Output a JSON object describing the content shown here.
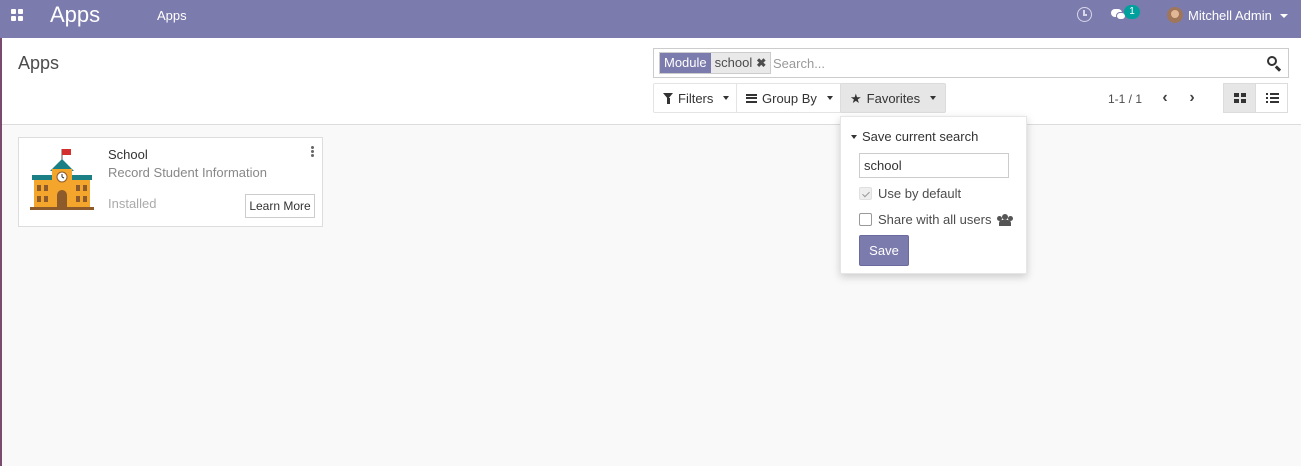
{
  "navbar": {
    "brand": "Apps",
    "menu_item": "Apps",
    "notification_count": "1",
    "user_name": "Mitchell Admin",
    "icons": [
      "apps-grid-icon",
      "clock-icon",
      "chat-icon",
      "avatar"
    ]
  },
  "control_panel": {
    "breadcrumb": "Apps",
    "search": {
      "facet_label": "Module",
      "facet_value": "school",
      "facet_remove": "✖",
      "placeholder": "Search..."
    },
    "filters_label": "Filters",
    "groupby_label": "Group By",
    "favorites_label": "Favorites",
    "pager": "1-1 / 1",
    "pager_prev": "‹",
    "pager_next": "›"
  },
  "favorites_menu": {
    "title": "Save current search",
    "name_value": "school",
    "use_by_default": "Use by default",
    "use_by_default_checked": true,
    "share_all": "Share with all users",
    "share_all_checked": false,
    "save_label": "Save"
  },
  "kanban": {
    "cards": [
      {
        "name": "School",
        "summary": "Record Student Information",
        "status": "Installed",
        "action": "Learn More"
      }
    ]
  },
  "colors": {
    "navbar": "#7c7bad",
    "badge": "#00a09d",
    "primary_button": "#7c7bad"
  }
}
